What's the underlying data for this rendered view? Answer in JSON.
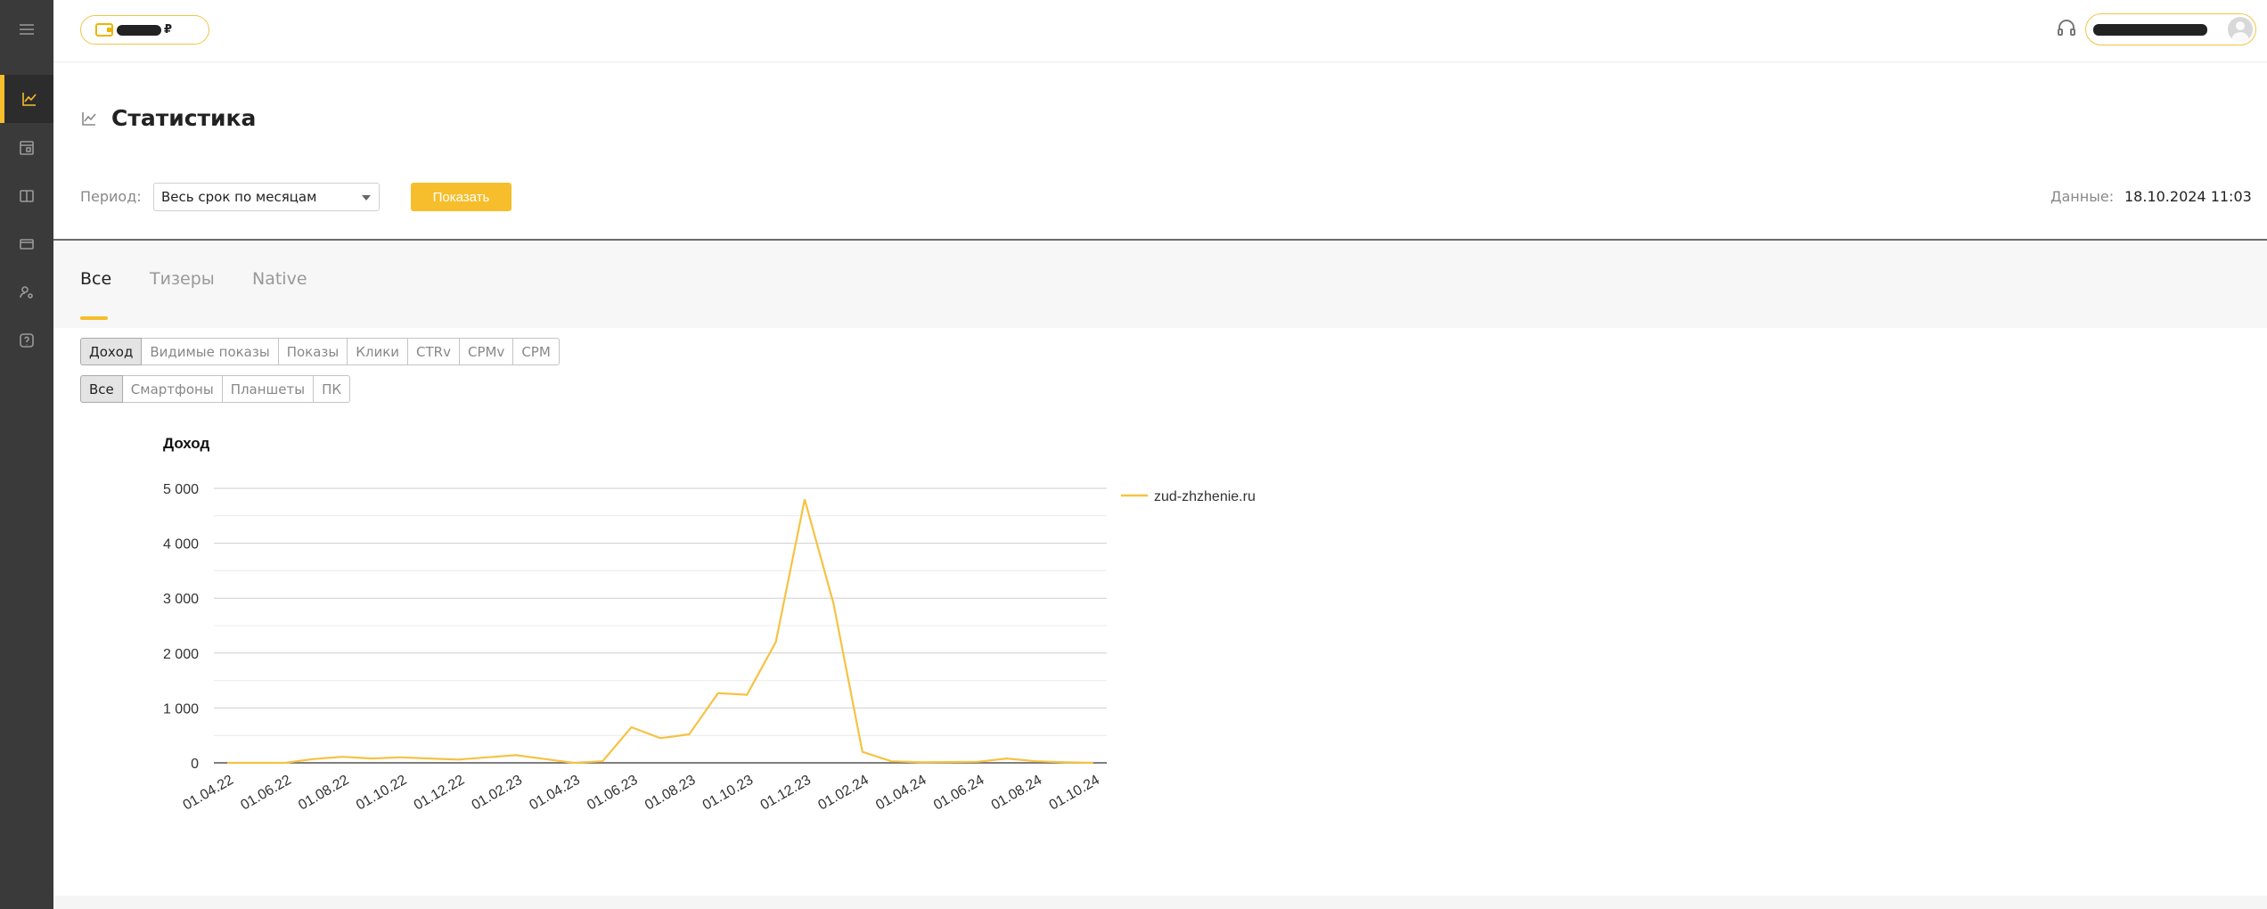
{
  "balance": {
    "currency": "₽"
  },
  "header": {
    "title": "Статистика"
  },
  "filters": {
    "period_label": "Период:",
    "period_value": "Весь срок по месяцам",
    "show_button": "Показать",
    "data_label": "Данные:",
    "data_value": "18.10.2024 11:03"
  },
  "tabs": [
    {
      "label": "Все",
      "active": true
    },
    {
      "label": "Тизеры",
      "active": false
    },
    {
      "label": "Native",
      "active": false
    }
  ],
  "metrics": [
    {
      "label": "Доход",
      "active": true
    },
    {
      "label": "Видимые показы",
      "active": false
    },
    {
      "label": "Показы",
      "active": false
    },
    {
      "label": "Клики",
      "active": false
    },
    {
      "label": "CTRv",
      "active": false
    },
    {
      "label": "CPMv",
      "active": false
    },
    {
      "label": "CPM",
      "active": false
    }
  ],
  "devices": [
    {
      "label": "Все",
      "active": true
    },
    {
      "label": "Смартфоны",
      "active": false
    },
    {
      "label": "Планшеты",
      "active": false
    },
    {
      "label": "ПК",
      "active": false
    }
  ],
  "sidebar": {
    "items": [
      {
        "icon": "menu-icon"
      },
      {
        "icon": "chart-line-icon",
        "active": true
      },
      {
        "icon": "widget-icon"
      },
      {
        "icon": "book-icon"
      },
      {
        "icon": "card-icon"
      },
      {
        "icon": "user-settings-icon"
      },
      {
        "icon": "help-icon"
      }
    ]
  },
  "colors": {
    "accent": "#f6be2c",
    "series": "#f6c243",
    "sidebar": "#3a3a3a"
  },
  "chart_data": {
    "type": "line",
    "title": "Доход",
    "ylim": [
      0,
      5000
    ],
    "yticks": [
      0,
      1000,
      2000,
      3000,
      4000,
      5000
    ],
    "ytick_labels": [
      "0",
      "1 000",
      "2 000",
      "3 000",
      "4 000",
      "5 000"
    ],
    "x": [
      "01.04.22",
      "01.05.22",
      "01.06.22",
      "01.07.22",
      "01.08.22",
      "01.09.22",
      "01.10.22",
      "01.11.22",
      "01.12.22",
      "01.01.23",
      "01.02.23",
      "01.03.23",
      "01.04.23",
      "01.05.23",
      "01.06.23",
      "01.07.23",
      "01.08.23",
      "01.09.23",
      "01.10.23",
      "01.11.23",
      "01.12.23",
      "01.01.24",
      "01.02.24",
      "01.03.24",
      "01.04.24",
      "01.05.24",
      "01.06.24",
      "01.07.24",
      "01.08.24",
      "01.09.24",
      "01.10.24"
    ],
    "xtick_labels": [
      "01.04.22",
      "01.06.22",
      "01.08.22",
      "01.10.22",
      "01.12.22",
      "01.02.23",
      "01.04.23",
      "01.06.23",
      "01.08.23",
      "01.10.23",
      "01.12.23",
      "01.02.24",
      "01.04.24",
      "01.06.24",
      "01.08.24",
      "01.10.24"
    ],
    "series": [
      {
        "name": "zud-zhzhenie.ru",
        "values": [
          0,
          0,
          0,
          70,
          110,
          80,
          100,
          80,
          60,
          100,
          140,
          70,
          0,
          30,
          650,
          450,
          520,
          1270,
          1240,
          2200,
          4800,
          2900,
          200,
          30,
          10,
          15,
          20,
          80,
          30,
          10,
          0
        ]
      }
    ],
    "grid": true,
    "legend": "right"
  }
}
